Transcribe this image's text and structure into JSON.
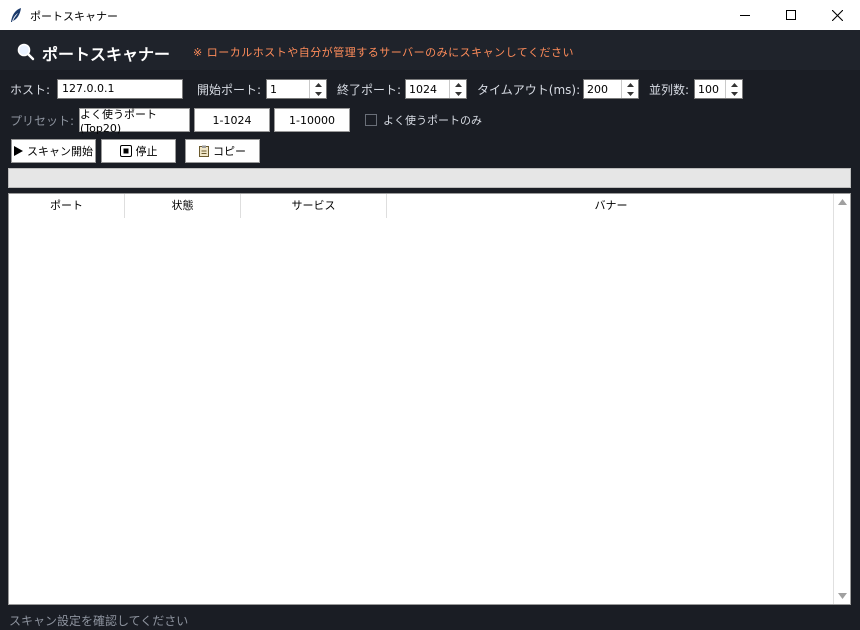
{
  "window": {
    "title": "ポートスキャナー"
  },
  "header": {
    "title": "ポートスキャナー",
    "warning": "※ ローカルホストや自分が管理するサーバーのみにスキャンしてください"
  },
  "form": {
    "host_label": "ホスト:",
    "host_value": "127.0.0.1",
    "start_label": "開始ポート:",
    "start_value": "1",
    "end_label": "終了ポート:",
    "end_value": "1024",
    "timeout_label": "タイムアウト(ms):",
    "timeout_value": "200",
    "parallel_label": "並列数:",
    "parallel_value": "100"
  },
  "presets": {
    "label": "プリセット:",
    "buttons": [
      "よく使うポート(Top20)",
      "1-1024",
      "1-10000"
    ],
    "common_only_label": "よく使うポートのみ",
    "common_only_checked": false
  },
  "actions": {
    "start": "スキャン開始",
    "stop": "停止",
    "copy": "コピー"
  },
  "progress": {
    "value": 0
  },
  "table": {
    "columns": [
      "ポート",
      "状態",
      "サービス",
      "バナー"
    ],
    "rows": []
  },
  "status": "スキャン設定を確認してください",
  "colors": {
    "header_bg": "#1f232b",
    "warning": "#ff8c5a",
    "panel_bg": "#1a1d24"
  }
}
